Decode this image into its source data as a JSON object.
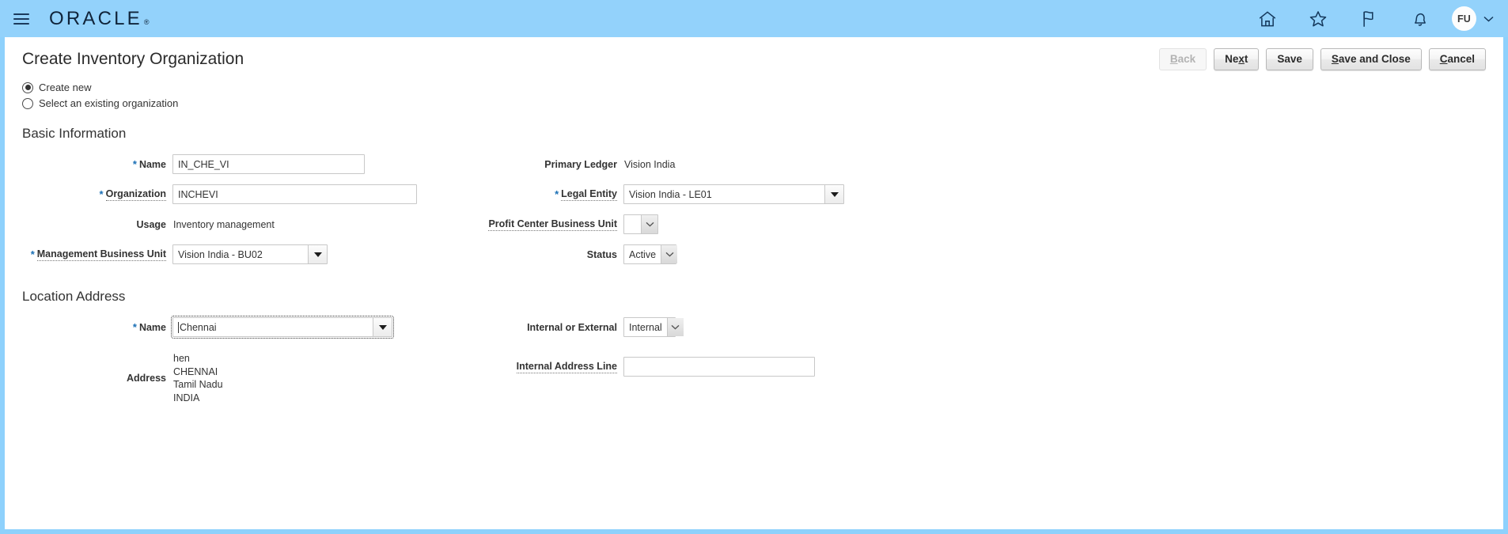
{
  "globalheader": {
    "menu_icon": "hamburger-icon",
    "brand": "ORACLE",
    "brand_tm": "®",
    "icons": [
      {
        "name": "home-icon",
        "label": "Home"
      },
      {
        "name": "favorites-star-icon",
        "label": "Favorites and Recent Items"
      },
      {
        "name": "flag-icon",
        "label": "Watchlist"
      },
      {
        "name": "notifications-bell-icon",
        "label": "Notifications"
      }
    ],
    "avatar_initials": "FU",
    "avatar_chevron": "⌄"
  },
  "page": {
    "title": "Create Inventory Organization"
  },
  "actions": {
    "back": {
      "label": "Back",
      "accel": "B",
      "disabled": true
    },
    "next": {
      "label": "Next",
      "accel": "x",
      "disabled": false
    },
    "save": {
      "label": "Save",
      "accel": "",
      "disabled": false
    },
    "save_close": {
      "label": "Save and Close",
      "accel": "S",
      "disabled": false
    },
    "cancel": {
      "label": "Cancel",
      "accel": "C",
      "disabled": false
    }
  },
  "mode_options": [
    {
      "label": "Create new",
      "selected": true
    },
    {
      "label": "Select an existing organization",
      "selected": false
    }
  ],
  "basic_information": {
    "heading": "Basic Information",
    "name": {
      "label": "Name",
      "value": "IN_CHE_VI",
      "required": true
    },
    "organization": {
      "label": "Organization",
      "value": "INCHEVI",
      "required": true
    },
    "usage": {
      "label": "Usage",
      "value": "Inventory management"
    },
    "management_business_unit": {
      "label": "Management Business Unit",
      "value": "Vision India - BU02",
      "required": true
    },
    "primary_ledger": {
      "label": "Primary Ledger",
      "value": "Vision India"
    },
    "legal_entity": {
      "label": "Legal Entity",
      "value": "Vision India - LE01",
      "required": true
    },
    "profit_center_business_unit": {
      "label": "Profit Center Business Unit",
      "value": ""
    },
    "status": {
      "label": "Status",
      "value": "Active"
    }
  },
  "location_address": {
    "heading": "Location Address",
    "name": {
      "label": "Name",
      "value": "Chennai",
      "required": true
    },
    "address": {
      "label": "Address",
      "lines": [
        "hen",
        "CHENNAI",
        "Tamil Nadu",
        "INDIA"
      ]
    },
    "internal_or_external": {
      "label": "Internal or External",
      "value": "Internal"
    },
    "internal_address_line": {
      "label": "Internal Address Line",
      "value": "",
      "placeholder": ""
    }
  },
  "colors": {
    "header_blue": "#93d2fb",
    "required_marker": "#1a6fb5",
    "text": "#333333"
  }
}
